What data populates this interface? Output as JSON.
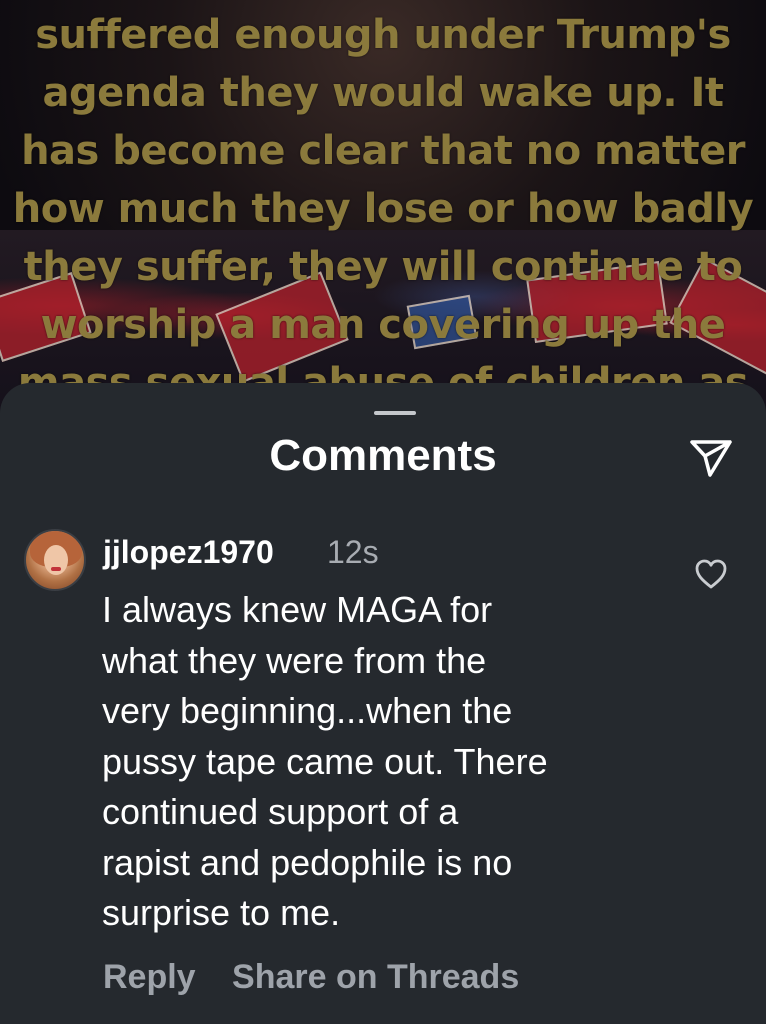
{
  "post": {
    "text_lines": [
      "suffered enough under Trump's",
      "agenda they would wake up. It",
      "has become clear that no matter",
      "how much they lose or how badly",
      "they suffer, they will continue to",
      "worship a man covering up the",
      "mass sexual abuse of children as"
    ]
  },
  "sheet": {
    "title": "Comments",
    "share_icon": "send-icon"
  },
  "comment": {
    "username": "jjlopez1970",
    "timestamp": "12s",
    "text_lines": [
      "I always knew MAGA for",
      "what they were from the",
      "very beginning...when the",
      "pussy tape came out. There",
      "continued support of a",
      "rapist and pedophile is no",
      "surprise to me."
    ],
    "like_icon": "heart-outline-icon",
    "actions": {
      "reply": "Reply",
      "share_threads": "Share on Threads"
    }
  },
  "colors": {
    "sheet_background": "#25292e",
    "post_text": "#8b7a3c",
    "secondary_text": "#a8acb2",
    "action_text": "#9ea3aa"
  }
}
